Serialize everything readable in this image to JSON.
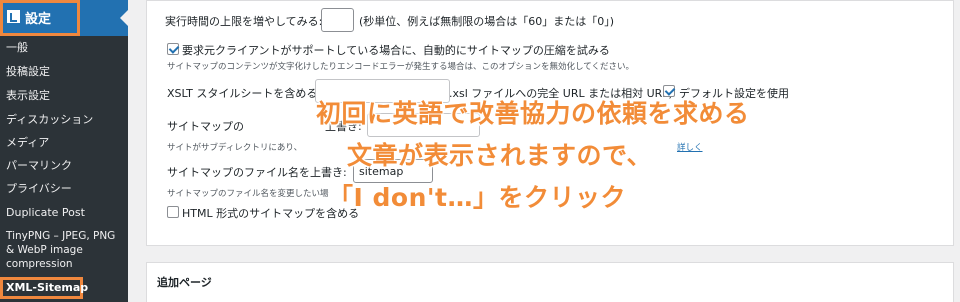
{
  "sidebar": {
    "current": {
      "label": "設定",
      "icon": "settings-icon"
    },
    "items": [
      {
        "label": "一般"
      },
      {
        "label": "投稿設定"
      },
      {
        "label": "表示設定"
      },
      {
        "label": "ディスカッション"
      },
      {
        "label": "メディア"
      },
      {
        "label": "パーマリンク"
      },
      {
        "label": "プライバシー"
      },
      {
        "label": "Duplicate Post"
      },
      {
        "label": "TinyPNG – JPEG, PNG & WebP image compression"
      }
    ],
    "xml_sitemap": "XML-Sitemap"
  },
  "settings": {
    "time_limit_label": "実行時間の上限を増やしてみる:",
    "time_limit_value": "",
    "time_limit_hint": "(秒単位、例えば無制限の場合は「60」または「0」)",
    "compress_label": "要求元クライアントがサポートしている場合に、自動的にサイトマップの圧縮を試みる",
    "compress_checked": true,
    "compress_desc": "サイトマップのコンテンツが文字化けしたりエンコードエラーが発生する場合は、このオプションを無効化してください。",
    "xslt_label": "XSLT スタイルシートを含める:",
    "xslt_tail": ".xsl ファイルへの完全 URL または相対 URL)",
    "xslt_default_label": "デフォルト設定を使用",
    "xslt_default_checked": true,
    "location_label": "サイトマップの",
    "location_tail": "上書き:",
    "location_desc": "サイトがサブディレクトリにあり、",
    "learn_more": "詳しく",
    "filename_label": "サイトマップのファイル名を上書き:",
    "filename_value": "sitemap",
    "filename_desc": "サイトマップのファイル名を変更したい場",
    "html_label": "HTML 形式のサイトマップを含める",
    "html_checked": false
  },
  "additional_pages": {
    "title": "追加ページ"
  },
  "overlay": {
    "line1": "初回に英語で改善協力の依頼を求める",
    "line2": "文章が表示されますので、",
    "line3": "「I don't…」をクリック",
    "color": "#f28c38"
  },
  "colors": {
    "sidebar_bg": "#1d2327",
    "submenu_bg": "#2c3338",
    "accent": "#2271b1",
    "highlight_box": "#f0883e"
  }
}
